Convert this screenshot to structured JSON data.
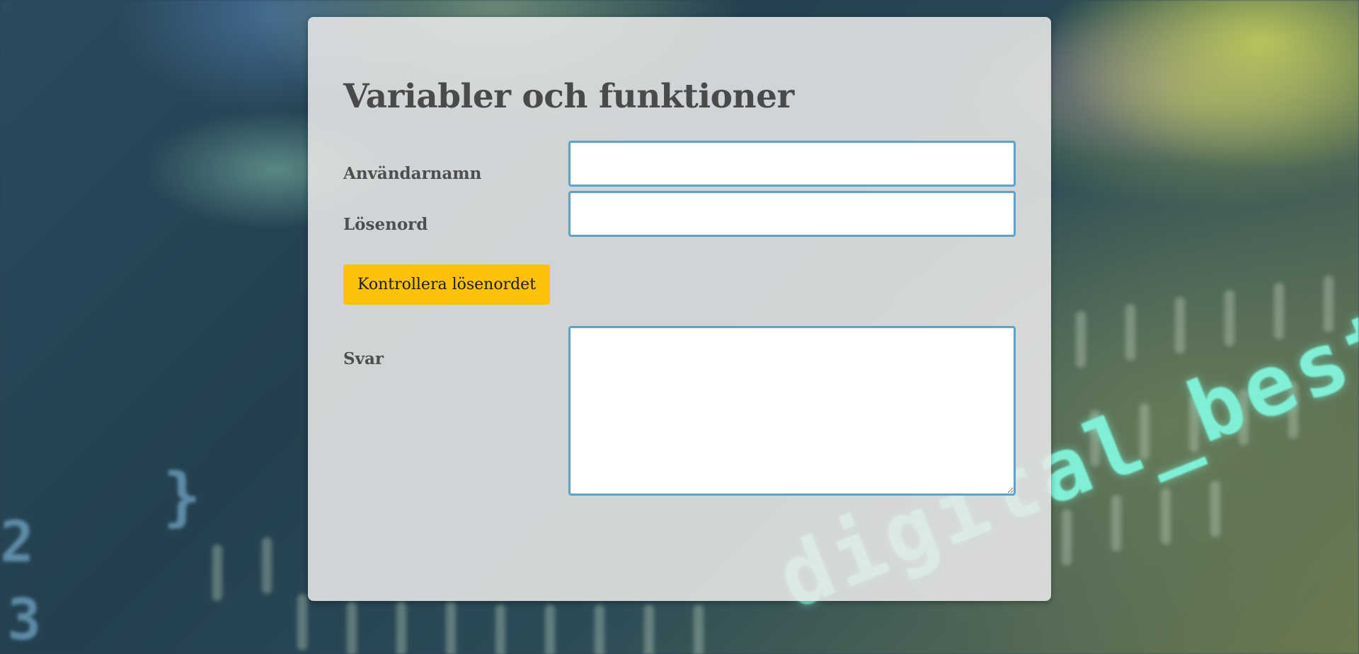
{
  "form": {
    "title": "Variabler och funktioner",
    "username_label": "Användarnamn",
    "username_value": "",
    "password_label": "Lösenord",
    "password_value": "",
    "check_button_label": "Kontrollera lösenordet",
    "answer_label": "Svar",
    "answer_value": ""
  },
  "background": {
    "code_text": "digital_best",
    "glyphs": [
      "}",
      "2",
      "3"
    ]
  },
  "colors": {
    "button": "#fcc10a",
    "field_border": "#5ea2c7",
    "panel": "#e8e8e8",
    "text": "#4a4a4a"
  }
}
